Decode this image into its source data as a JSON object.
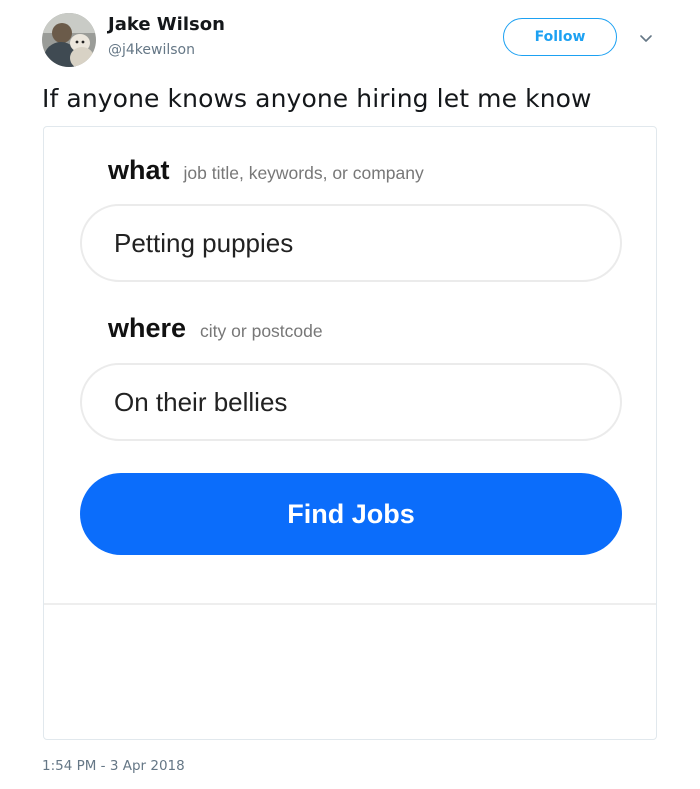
{
  "author": {
    "name": "Jake Wilson",
    "handle": "@j4kewilson"
  },
  "follow_button": "Follow",
  "more_menu_icon": "chevron-down-icon",
  "tweet_text": "If anyone knows anyone hiring let me know",
  "job_search": {
    "what_label": "what",
    "what_hint": "job title, keywords, or company",
    "what_value": "Petting puppies",
    "where_label": "where",
    "where_hint": "city or postcode",
    "where_value": "On their bellies",
    "find_button": "Find Jobs"
  },
  "timestamp": "1:54 PM - 3 Apr 2018",
  "colors": {
    "twitter_blue": "#1da1f2",
    "find_jobs_blue": "#0b6dfb",
    "name_text": "#14171a",
    "secondary_text": "#657786"
  }
}
